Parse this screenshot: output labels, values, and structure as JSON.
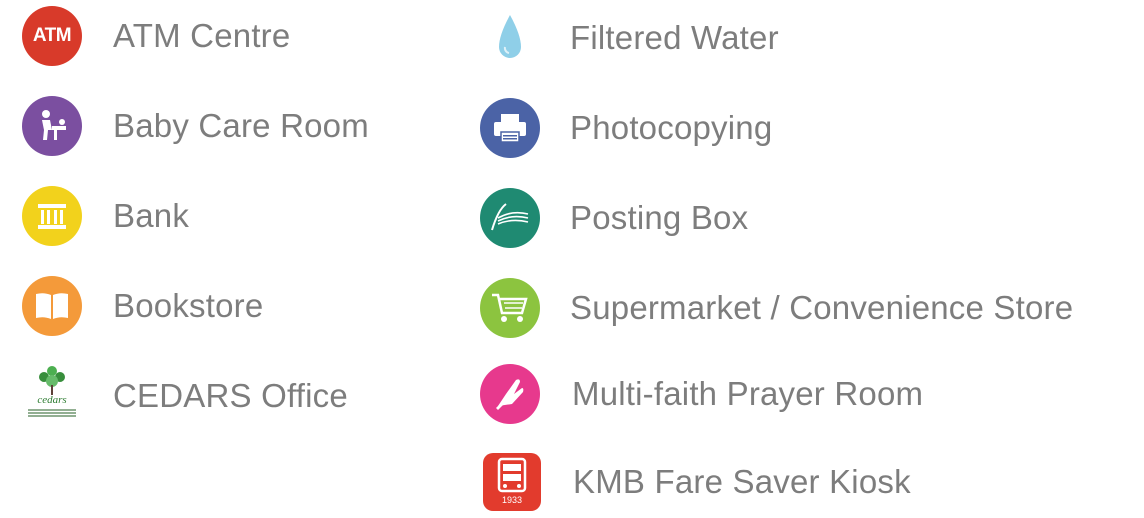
{
  "colors": {
    "label": "#7d7d7d",
    "atm": "#d83a2a",
    "baby": "#7b4fa0",
    "bank": "#f2d21c",
    "bookstore": "#f49a3a",
    "cedars": "#3f8f3f",
    "water": "#7fc6e3",
    "photocopy": "#4b63a6",
    "posting": "#1f8a72",
    "supermarket": "#8cc43f",
    "prayer": "#e7398d",
    "kmb": "#e23b2d"
  },
  "left": [
    {
      "label": "ATM Centre",
      "icon": "atm-icon"
    },
    {
      "label": "Baby Care Room",
      "icon": "baby-care-icon"
    },
    {
      "label": "Bank",
      "icon": "bank-icon"
    },
    {
      "label": "Bookstore",
      "icon": "book-icon"
    },
    {
      "label": "CEDARS Office",
      "icon": "cedars-logo-icon"
    }
  ],
  "right": [
    {
      "label": "Filtered Water",
      "icon": "water-drop-icon"
    },
    {
      "label": "Photocopying",
      "icon": "printer-icon"
    },
    {
      "label": "Posting Box",
      "icon": "posting-box-icon"
    },
    {
      "label": "Supermarket / Convenience Store",
      "icon": "shopping-cart-icon"
    },
    {
      "label": "Multi-faith Prayer Room",
      "icon": "praying-hands-icon"
    },
    {
      "label": "KMB Fare Saver Kiosk",
      "icon": "bus-icon"
    }
  ],
  "atm_icon_text": "ATM",
  "cedars_logo_text": "cedars",
  "kmb_icon_text": "1933"
}
